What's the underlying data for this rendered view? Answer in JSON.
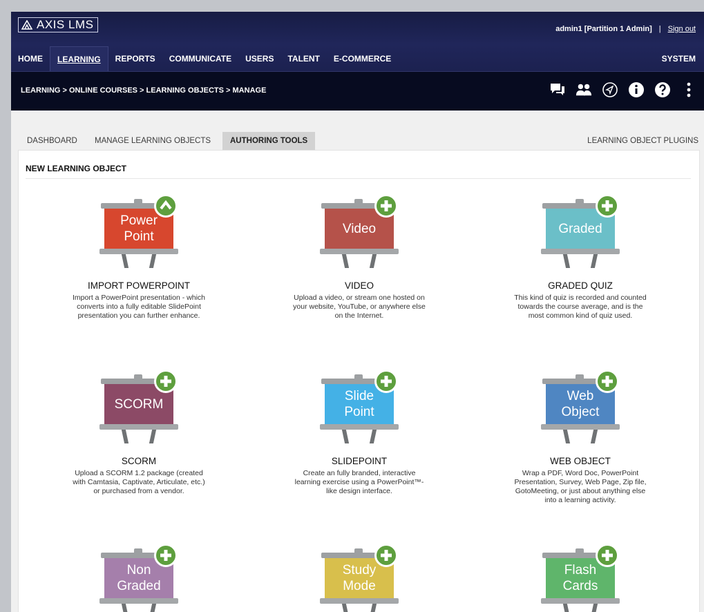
{
  "app": {
    "logo_text": "AXIS LMS",
    "user": "admin1 [Partition 1 Admin]",
    "separator": "|",
    "signout": "Sign out"
  },
  "nav": {
    "items": [
      {
        "label": "HOME"
      },
      {
        "label": "LEARNING"
      },
      {
        "label": "REPORTS"
      },
      {
        "label": "COMMUNICATE"
      },
      {
        "label": "USERS"
      },
      {
        "label": "TALENT"
      },
      {
        "label": "E-COMMERCE"
      }
    ],
    "system": "SYSTEM"
  },
  "breadcrumb": "LEARNING > ONLINE COURSES > LEARNING OBJECTS > MANAGE",
  "toolbar_icons": [
    "chat-icon",
    "people-icon",
    "navigate-icon",
    "info-icon",
    "help-icon",
    "more-icon"
  ],
  "subtabs": {
    "items": [
      {
        "label": "DASHBOARD"
      },
      {
        "label": "MANAGE LEARNING OBJECTS"
      },
      {
        "label": "AUTHORING TOOLS"
      }
    ],
    "plugins": "LEARNING OBJECT PLUGINS"
  },
  "panel": {
    "title": "NEW LEARNING OBJECT"
  },
  "colors": {
    "badge_green": "#5e9f3e",
    "nav_bg": "#1c2150",
    "crumb_bg": "#070b20"
  },
  "tiles": [
    {
      "board": "Power\nPoint",
      "color": "#d7472e",
      "badge": "up-arrow-icon",
      "title": "IMPORT POWERPOINT",
      "desc": "Import a PowerPoint presentation - which converts into a fully editable SlidePoint presentation you can further enhance."
    },
    {
      "board": "Video",
      "color": "#b5524a",
      "badge": "plus-icon",
      "title": "VIDEO",
      "desc": "Upload a video, or stream one hosted on your website, YouTube, or anywhere else on the Internet."
    },
    {
      "board": "Graded",
      "color": "#6bbfc8",
      "badge": "plus-icon",
      "title": "GRADED QUIZ",
      "desc": "This kind of quiz is recorded and counted towards the course average, and is the most common kind of quiz used."
    },
    {
      "board": "SCORM",
      "color": "#8c4a66",
      "badge": "plus-icon",
      "title": "SCORM",
      "desc": "Upload a SCORM 1.2 package (created with Camtasia, Captivate, Articulate, etc.) or purchased from a vendor."
    },
    {
      "board": "Slide\nPoint",
      "color": "#44b1e6",
      "badge": "plus-icon",
      "title": "SLIDEPOINT",
      "desc": "Create an fully branded, interactive learning exercise using a PowerPoint™-like design interface."
    },
    {
      "board": "Web\nObject",
      "color": "#4f86c2",
      "badge": "plus-icon",
      "title": "WEB OBJECT",
      "desc": "Wrap a PDF, Word Doc, PowerPoint Presentation, Survey, Web Page, Zip file, GotoMeeting, or just about anything else into a learning activity."
    },
    {
      "board": "Non\nGraded",
      "color": "#a57fab",
      "badge": "plus-icon",
      "title": "",
      "desc": ""
    },
    {
      "board": "Study\nMode",
      "color": "#d8bf4c",
      "badge": "plus-icon",
      "title": "",
      "desc": ""
    },
    {
      "board": "Flash\nCards",
      "color": "#5fb56b",
      "badge": "plus-icon",
      "title": "",
      "desc": ""
    }
  ]
}
